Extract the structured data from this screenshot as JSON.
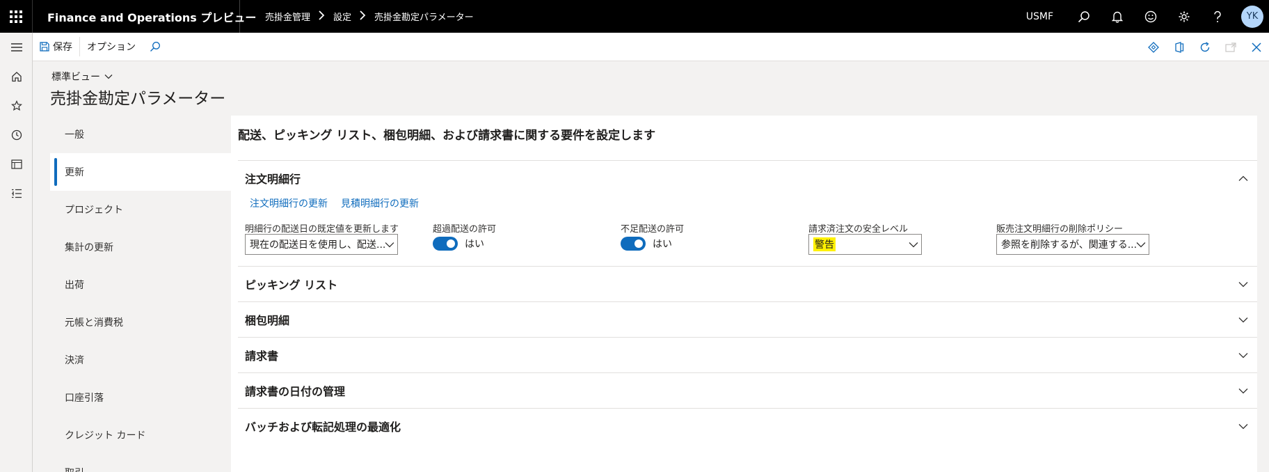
{
  "topbar": {
    "app_name": "Finance and Operations プレビュー",
    "breadcrumbs": [
      "売掛金管理",
      "設定",
      "売掛金勘定パラメーター"
    ],
    "company": "USMF",
    "user_initials": "YK"
  },
  "actionpane": {
    "save_label": "保存",
    "options_label": "オプション"
  },
  "page": {
    "view_selector": "標準ビュー",
    "title": "売掛金勘定パラメーター"
  },
  "tabs": [
    {
      "label": "一般",
      "active": false
    },
    {
      "label": "更新",
      "active": true
    },
    {
      "label": "プロジェクト",
      "active": false
    },
    {
      "label": "集計の更新",
      "active": false
    },
    {
      "label": "出荷",
      "active": false
    },
    {
      "label": "元帳と消費税",
      "active": false
    },
    {
      "label": "決済",
      "active": false
    },
    {
      "label": "口座引落",
      "active": false
    },
    {
      "label": "クレジット カード",
      "active": false
    },
    {
      "label": "取引",
      "active": false
    }
  ],
  "content": {
    "title": "配送、ピッキング リスト、梱包明細、および請求書に関する要件を設定します",
    "order_lines": {
      "header": "注文明細行",
      "links": [
        "注文明細行の更新",
        "見積明細行の更新"
      ],
      "fields": {
        "delivery_date": {
          "label": "明細行の配送日の既定値を更新します",
          "value": "現在の配送日を使用し、配送..."
        },
        "over_delivery": {
          "label": "超過配送の許可",
          "value": "はい",
          "on": true
        },
        "under_delivery": {
          "label": "不足配送の許可",
          "value": "はい",
          "on": true
        },
        "safety_level": {
          "label": "請求済注文の安全レベル",
          "value": "警告"
        },
        "deletion_policy": {
          "label": "販売注文明細行の削除ポリシー",
          "value": "参照を削除するが、関連する..."
        }
      }
    },
    "sections": [
      "ピッキング リスト",
      "梱包明細",
      "請求書",
      "請求書の日付の管理",
      "バッチおよび転記処理の最適化"
    ]
  }
}
